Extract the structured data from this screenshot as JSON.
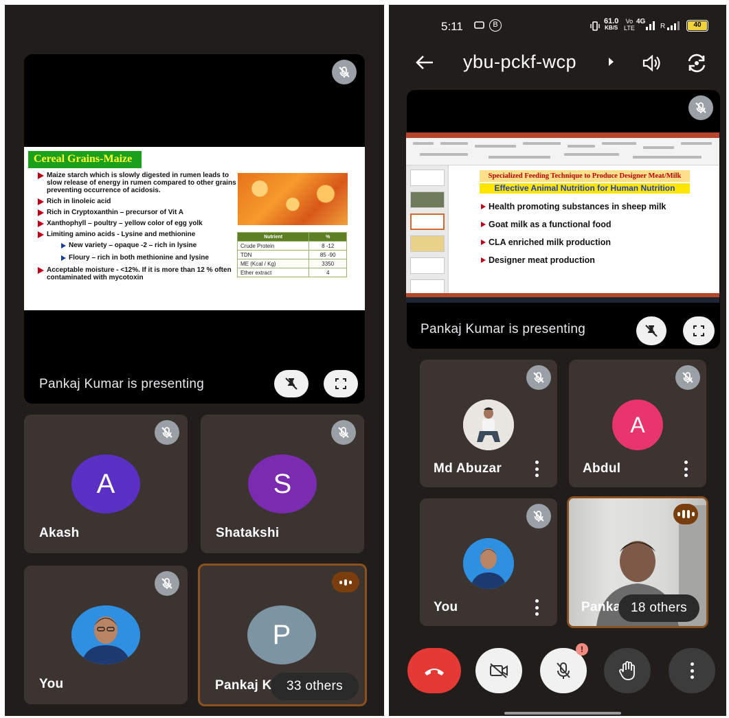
{
  "left": {
    "presenting_text": "Pankaj Kumar is presenting",
    "slide": {
      "title": "Cereal Grains-Maize",
      "bullets": [
        {
          "text": "Maize starch which is slowly digested in rumen leads to slow release of energy in rumen compared to other grains preventing occurrence of acidosis."
        },
        {
          "text": "Rich in linoleic acid"
        },
        {
          "text": "Rich in Cryptoxanthin – precursor of Vit A"
        },
        {
          "text": "Xanthophyll – poultry – yellow color of egg yolk"
        },
        {
          "text": "Limiting amino acids - Lysine and methionine"
        }
      ],
      "sub_bullets": [
        "New variety – opaque -2 – rich in lysine",
        "Floury – rich in both methionine and lysine"
      ],
      "last_bullet": "Acceptable moisture - <12%. If it is more than 12 % often contaminated with mycotoxin",
      "table": {
        "headers": [
          "Nutrient",
          "%"
        ],
        "rows": [
          [
            "Crude Protein",
            "8 -12"
          ],
          [
            "TDN",
            "85 -90"
          ],
          [
            "ME (Kcal / Kg)",
            "3350"
          ],
          [
            "Ether extract",
            "4"
          ]
        ]
      }
    },
    "tiles": [
      {
        "name": "Akash",
        "initial": "A",
        "color": "#5a2fc4"
      },
      {
        "name": "Shatakshi",
        "initial": "S",
        "color": "#7a2bb0"
      },
      {
        "name": "You"
      },
      {
        "name": "Pankaj Ku",
        "initial": "P",
        "color": "#7d95a3",
        "others": "33 others"
      }
    ]
  },
  "right": {
    "status": {
      "time": "5:11",
      "speed_value": "61.0",
      "speed_unit": "KB/S",
      "volte_top": "Vo",
      "volte_bottom": "LTE",
      "network": "4G",
      "network_r": "R",
      "battery": "40"
    },
    "meeting_code": "ybu-pckf-wcp",
    "presenting_text": "Pankaj Kumar is presenting",
    "slide": {
      "heading1": "Specialized Feeding Technique to Produce Designer Meat/Milk",
      "heading2": "Effective Animal Nutrition for Human Nutrition",
      "bullets": [
        "Health promoting substances in sheep milk",
        "Goat milk as a functional food",
        "CLA enriched milk production",
        "Designer meat production"
      ]
    },
    "tiles": [
      {
        "name": "Md Abuzar"
      },
      {
        "name": "Abdul",
        "initial": "A",
        "color": "#e8356d"
      },
      {
        "name": "You"
      },
      {
        "name": "Panka",
        "others": "18 others"
      }
    ],
    "controls": {
      "notification_badge": "!"
    }
  },
  "colors": {
    "end_call": "#e53935",
    "panel_bg": "#211d1b",
    "tile_bg": "#3c3431",
    "active_border": "#8a5220"
  }
}
